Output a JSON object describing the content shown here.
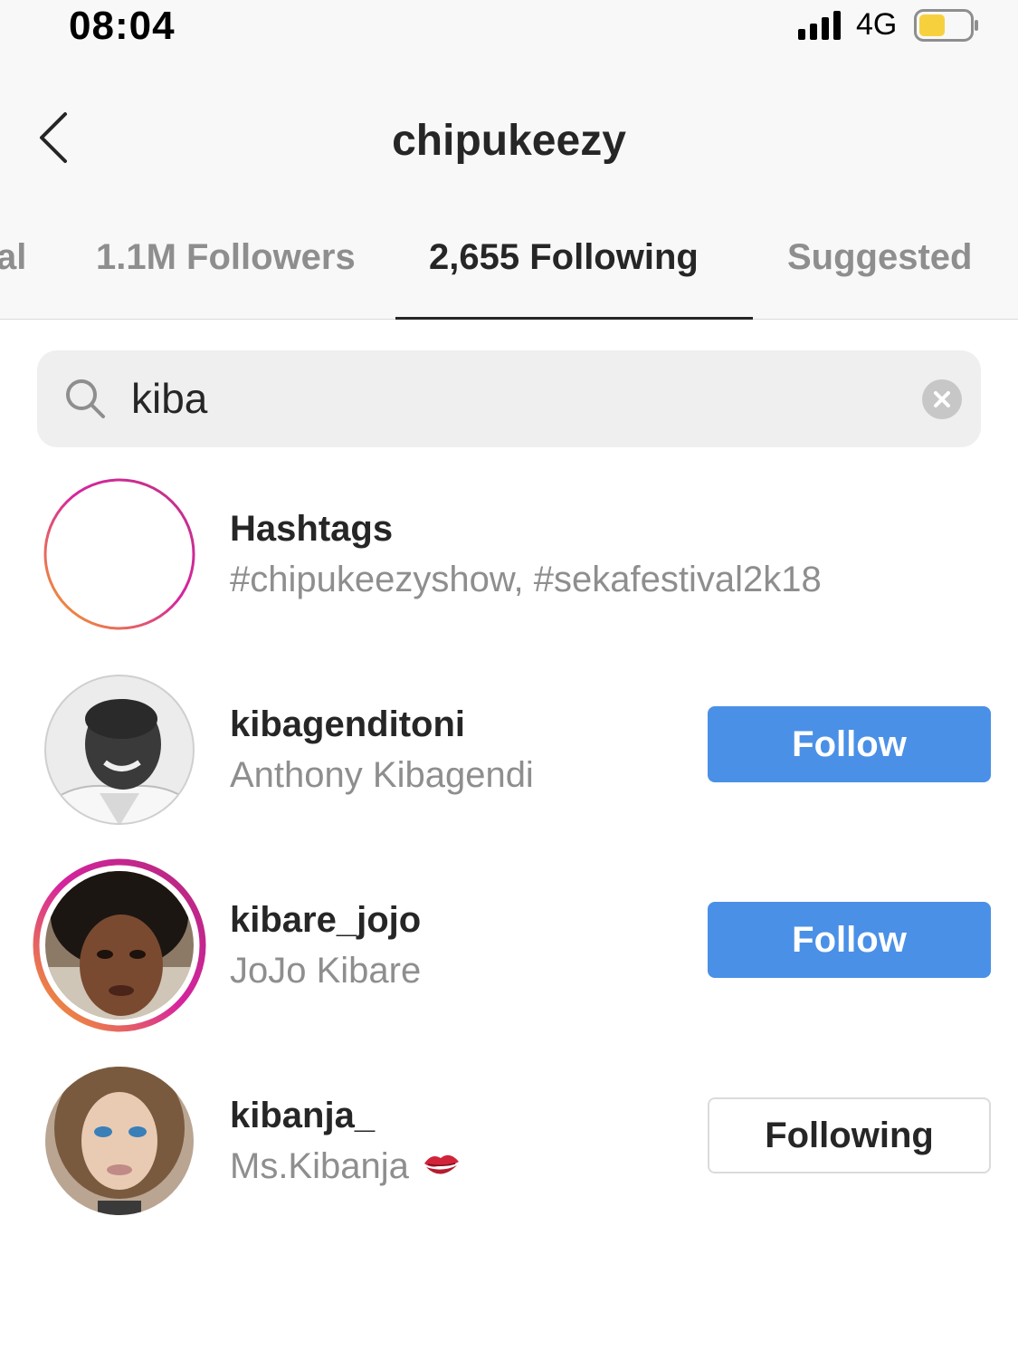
{
  "status_bar": {
    "time": "08:04",
    "network": "4G",
    "icons": [
      "signal-icon",
      "battery-icon"
    ]
  },
  "header": {
    "title": "chipukeezy",
    "back_icon": "chevron-left-icon"
  },
  "tabs": [
    {
      "label": "al",
      "active": false
    },
    {
      "label": "1.1M Followers",
      "active": false
    },
    {
      "label": "2,655 Following",
      "active": true
    },
    {
      "label": "Suggested",
      "active": false
    }
  ],
  "search": {
    "value": "kiba",
    "icons": [
      "search-icon",
      "clear-icon"
    ]
  },
  "hashtags": {
    "title": "Hashtags",
    "subtitle": "#chipukeezyshow, #sekafestival2k18",
    "icon": "hashtag-icon"
  },
  "users": [
    {
      "username": "kibagenditoni",
      "full_name": "Anthony Kibagendi",
      "button": "Follow",
      "state": "follow"
    },
    {
      "username": "kibare_jojo",
      "full_name": "JoJo Kibare",
      "button": "Follow",
      "state": "follow",
      "has_story_ring": true
    },
    {
      "username": "kibanja_",
      "full_name": "Ms.Kibanja",
      "full_name_emoji": "kiss-mark-icon",
      "button": "Following",
      "state": "following"
    }
  ],
  "colors": {
    "follow_button": "#4a90e6",
    "battery_fill": "#f7d13d",
    "story_gradient": [
      "#f5a623",
      "#d6249f",
      "#c13584"
    ]
  }
}
